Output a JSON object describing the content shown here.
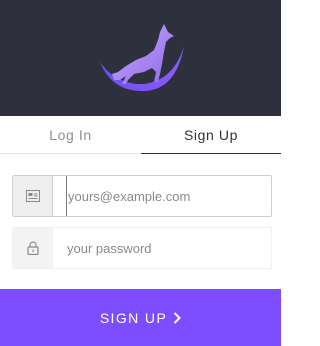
{
  "tabs": {
    "login_label": "Log In",
    "signup_label": "Sign Up",
    "active": "Sign Up"
  },
  "email": {
    "icon": "envelope-icon",
    "placeholder": "yours@example.com",
    "value": ""
  },
  "password": {
    "icon": "lock-icon",
    "placeholder": "your password",
    "value": ""
  },
  "submit": {
    "label": "SIGN UP",
    "icon": "chevron-right-icon"
  },
  "colors": {
    "header_bg": "#2e313d",
    "accent": "#7c4dff"
  }
}
